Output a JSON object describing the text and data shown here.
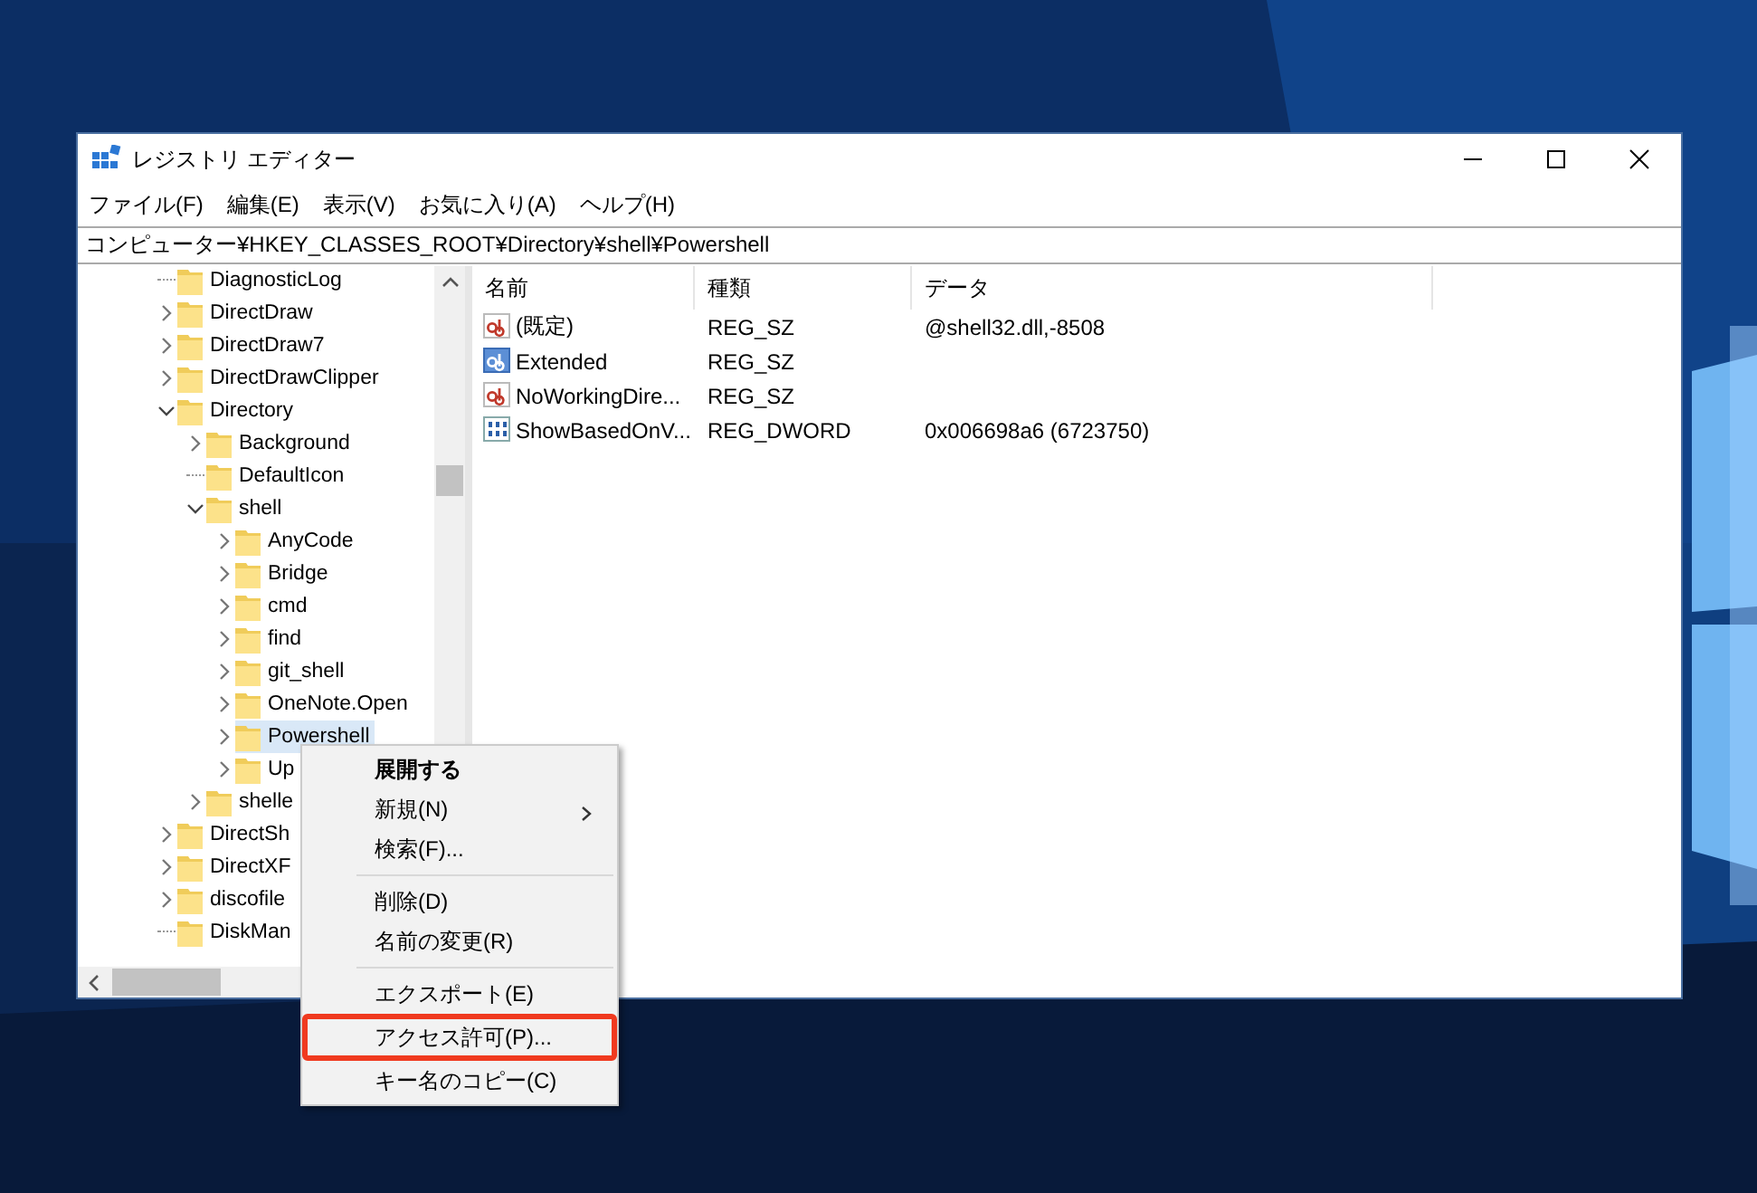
{
  "window": {
    "title": "レジストリ エディター"
  },
  "menu_bar": [
    "ファイル(F)",
    "編集(E)",
    "表示(V)",
    "お気に入り(A)",
    "ヘルプ(H)"
  ],
  "address": "コンピューター¥HKEY_CLASSES_ROOT¥Directory¥shell¥Powershell",
  "tree": {
    "items": [
      {
        "label": "DiagnosticLog",
        "has_children": false,
        "selected": false
      },
      {
        "label": "DirectDraw",
        "has_children": true,
        "expanded": false,
        "selected": false
      },
      {
        "label": "DirectDraw7",
        "has_children": true,
        "expanded": false,
        "selected": false
      },
      {
        "label": "DirectDrawClipper",
        "has_children": true,
        "expanded": false,
        "selected": false
      },
      {
        "label": "Directory",
        "has_children": true,
        "expanded": true,
        "selected": false,
        "children": [
          {
            "label": "Background",
            "has_children": true,
            "expanded": false,
            "selected": false
          },
          {
            "label": "DefaultIcon",
            "has_children": false,
            "selected": false
          },
          {
            "label": "shell",
            "has_children": true,
            "expanded": true,
            "selected": false,
            "children": [
              {
                "label": "AnyCode",
                "has_children": true,
                "expanded": false,
                "selected": false
              },
              {
                "label": "Bridge",
                "has_children": true,
                "expanded": false,
                "selected": false
              },
              {
                "label": "cmd",
                "has_children": true,
                "expanded": false,
                "selected": false
              },
              {
                "label": "find",
                "has_children": true,
                "expanded": false,
                "selected": false
              },
              {
                "label": "git_shell",
                "has_children": true,
                "expanded": false,
                "selected": false
              },
              {
                "label": "OneNote.Open",
                "has_children": true,
                "expanded": false,
                "selected": false
              },
              {
                "label": "Powershell",
                "has_children": true,
                "expanded": false,
                "selected": true
              },
              {
                "label": "Up",
                "has_children": true,
                "expanded": false,
                "selected": false
              }
            ]
          },
          {
            "label": "shelle",
            "has_children": true,
            "expanded": false,
            "selected": false
          }
        ]
      },
      {
        "label": "DirectSh",
        "has_children": true,
        "expanded": false,
        "selected": false
      },
      {
        "label": "DirectXF",
        "has_children": true,
        "expanded": false,
        "selected": false
      },
      {
        "label": "discofile",
        "has_children": true,
        "expanded": false,
        "selected": false
      },
      {
        "label": "DiskMan",
        "has_children": false,
        "selected": false
      }
    ]
  },
  "values": {
    "columns": [
      "名前",
      "種類",
      "データ"
    ],
    "rows": [
      {
        "name": "(既定)",
        "type": "REG_SZ",
        "data": "@shell32.dll,-8508",
        "kind": "string",
        "selected": false
      },
      {
        "name": "Extended",
        "type": "REG_SZ",
        "kind": "string",
        "selected": true
      },
      {
        "name": "NoWorkingDire...",
        "type": "REG_SZ",
        "kind": "string",
        "selected": false
      },
      {
        "name": "ShowBasedOnV...",
        "type": "REG_DWORD",
        "data": "0x006698a6 (6723750)",
        "kind": "dword",
        "selected": false
      }
    ]
  },
  "context_menu": {
    "items": [
      {
        "kind": "item",
        "label": "展開する",
        "default": true,
        "submenu": false,
        "highlighted": false
      },
      {
        "kind": "item",
        "label": "新規(N)",
        "default": false,
        "submenu": true,
        "highlighted": false
      },
      {
        "kind": "item",
        "label": "検索(F)...",
        "default": false,
        "submenu": false,
        "highlighted": false
      },
      {
        "kind": "separator"
      },
      {
        "kind": "item",
        "label": "削除(D)",
        "default": false,
        "submenu": false,
        "highlighted": false
      },
      {
        "kind": "item",
        "label": "名前の変更(R)",
        "default": false,
        "submenu": false,
        "highlighted": false
      },
      {
        "kind": "separator"
      },
      {
        "kind": "item",
        "label": "エクスポート(E)",
        "default": false,
        "submenu": false,
        "highlighted": false
      },
      {
        "kind": "item",
        "label": "アクセス許可(P)...",
        "default": false,
        "submenu": false,
        "highlighted": true
      },
      {
        "kind": "item",
        "label": "キー名のコピー(C)",
        "default": false,
        "submenu": false,
        "highlighted": false
      }
    ]
  }
}
